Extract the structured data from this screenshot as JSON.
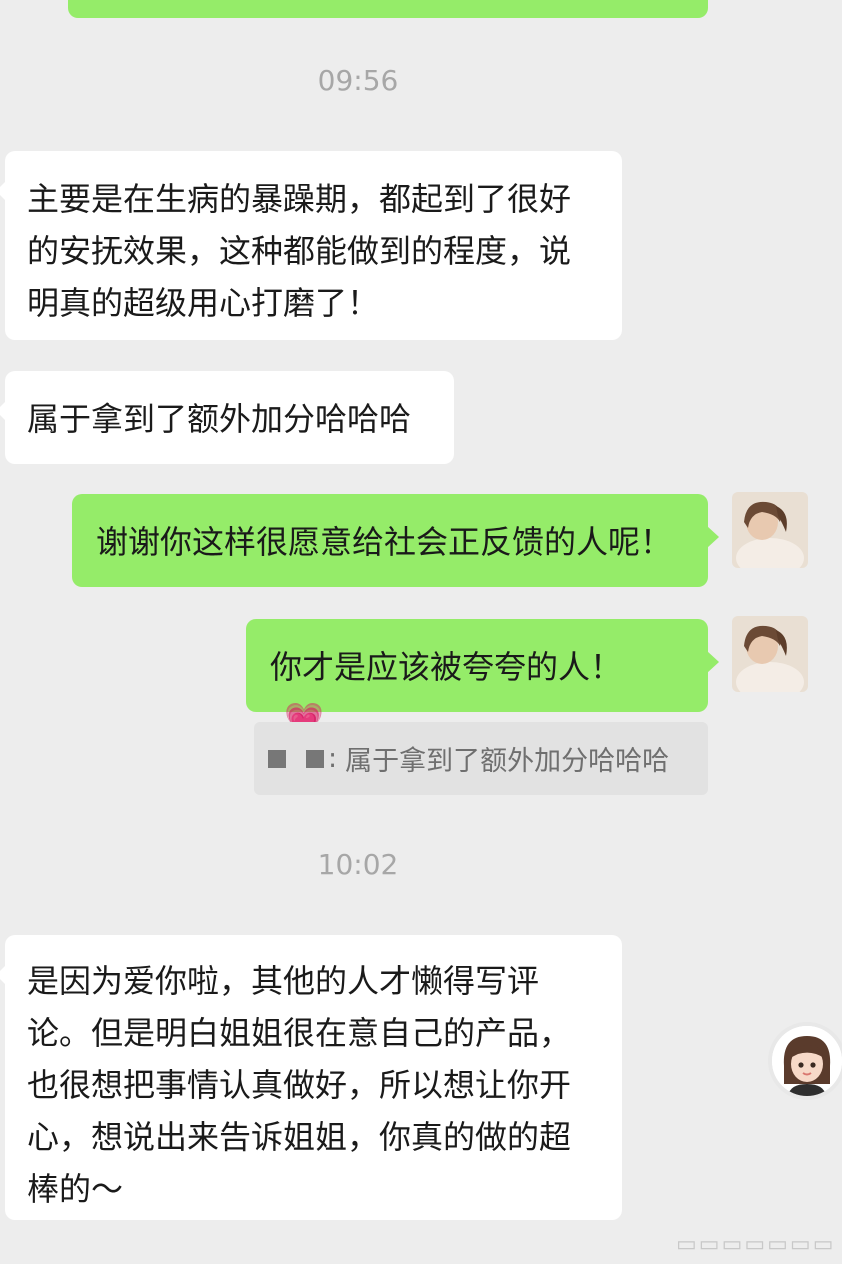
{
  "times": [
    "09:56",
    "10:02"
  ],
  "messages": {
    "in1": "主要是在生病的暴躁期，都起到了很好的安抚效果，这种都能做到的程度，说明真的超级用心打磨了！",
    "in2": "属于拿到了额外加分哈哈哈",
    "out1": "谢谢你这样很愿意给社会正反馈的人呢！",
    "out2": "你才是应该被夸夸的人！",
    "in3": "是因为爱你啦，其他的人才懒得写评论。但是明白姐姐很在意自己的产品，也很想把事情认真做好，所以想让你开心，想说出来告诉姐姐，你真的做的超棒的～"
  },
  "quote": {
    "prefix": ":",
    "text": "属于拿到了额外加分哈哈哈"
  },
  "emoji": "💗",
  "colors": {
    "outgoing_bubble": "#95ec69",
    "incoming_bubble": "#ffffff",
    "background": "#ededed"
  }
}
